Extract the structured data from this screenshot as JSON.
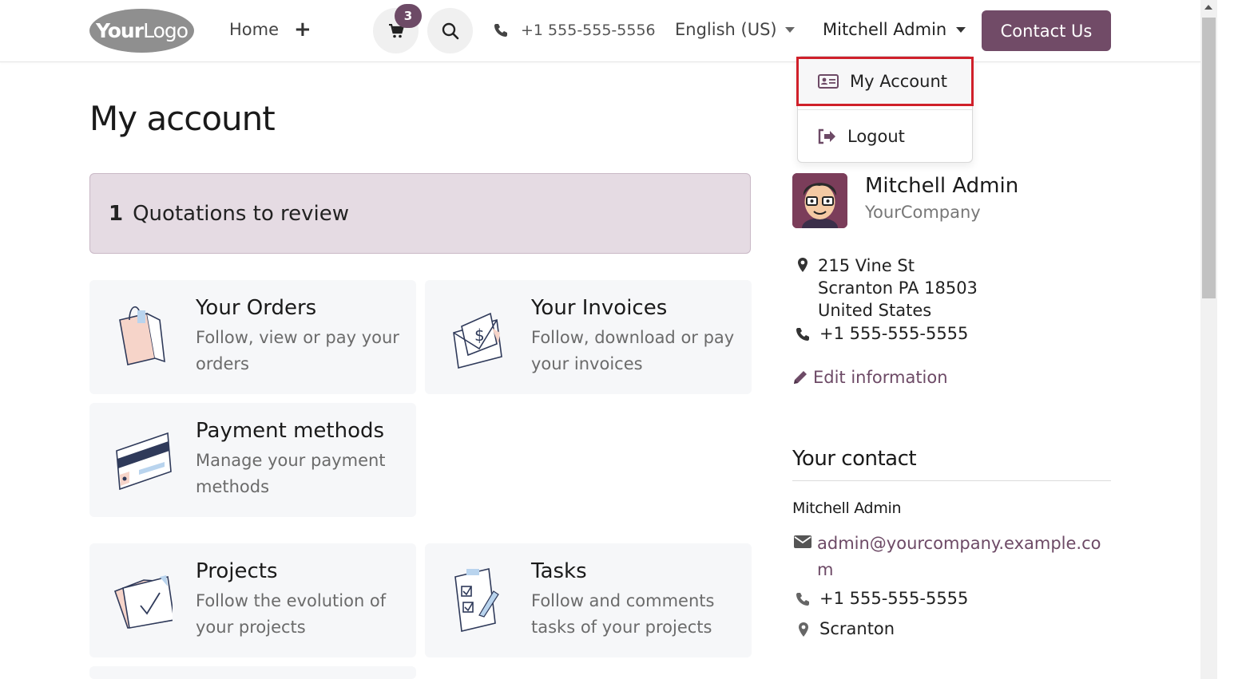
{
  "header": {
    "logo_text_bold": "Your",
    "logo_text_light": "Logo",
    "home_label": "Home",
    "plus_label": "+",
    "cart_count": "3",
    "phone": "+1 555-555-5556",
    "language": "English (US)",
    "user_name": "Mitchell Admin",
    "contact_button": "Contact Us"
  },
  "user_menu": {
    "items": [
      {
        "label": "My Account",
        "icon": "id-card-icon"
      },
      {
        "label": "Logout",
        "icon": "sign-out-icon"
      }
    ]
  },
  "page": {
    "title": "My account",
    "quotations_count": "1",
    "quotations_label": "Quotations to review"
  },
  "cards": [
    {
      "title": "Your Orders",
      "description": "Follow, view or pay your orders",
      "icon": "shopping-bag-icon"
    },
    {
      "title": "Your Invoices",
      "description": "Follow, download or pay your invoices",
      "icon": "invoice-envelope-icon"
    },
    {
      "title": "Payment methods",
      "description": "Manage your payment methods",
      "icon": "credit-card-icon"
    },
    {
      "title": "Projects",
      "description": "Follow the evolution of your projects",
      "icon": "folder-check-icon"
    },
    {
      "title": "Tasks",
      "description": "Follow and comments tasks of your projects",
      "icon": "checklist-icon"
    }
  ],
  "profile": {
    "name": "Mitchell Admin",
    "company": "YourCompany",
    "address_line1": "215 Vine St",
    "address_line2": "Scranton PA 18503",
    "address_line3": "United States",
    "phone": "+1 555-555-5555",
    "edit_label": "Edit information"
  },
  "your_contact": {
    "title": "Your contact",
    "name": "Mitchell Admin",
    "email": "admin@yourcompany.example.com",
    "phone": "+1 555-555-5555",
    "city": "Scranton"
  },
  "colors": {
    "brand": "#714b67",
    "highlight_border": "#d0202a",
    "quotation_bg": "#e5dbe3"
  }
}
